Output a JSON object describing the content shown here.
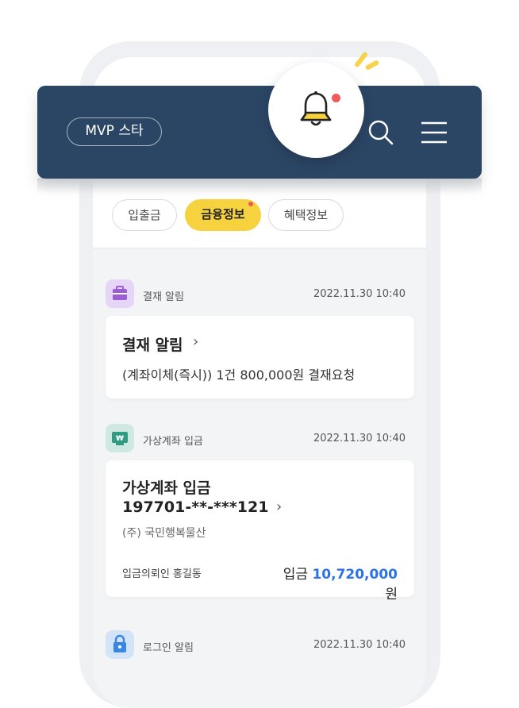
{
  "header": {
    "chip_label": "MVP 스타",
    "bell_icon": "bell-icon",
    "search_icon": "search-icon",
    "menu_icon": "hamburger-menu-icon"
  },
  "tabs": [
    {
      "label": "입출금",
      "active": false
    },
    {
      "label": "금융정보",
      "active": true,
      "has_new": true
    },
    {
      "label": "혜택정보",
      "active": false
    }
  ],
  "notifications": [
    {
      "icon": "briefcase-icon",
      "category": "결재 알림",
      "time": "2022.11.30 10:40",
      "title": "결재 알림",
      "description": "(계좌이체(즉시)) 1건 800,000원 결재요청"
    },
    {
      "icon": "virtual-account-icon",
      "category": "가상계좌 입금",
      "time": "2022.11.30 10:40",
      "title": "가상계좌 입금",
      "account": "197701-**-***121",
      "company": "(주) 국민행복물산",
      "depositor": "입금의뢰인 홍길동",
      "amount_prefix": "입금",
      "amount": "10,720,000",
      "amount_unit": "원"
    },
    {
      "icon": "lock-icon",
      "category": "로그인 알림",
      "time": "2022.11.30 10:40"
    }
  ],
  "colors": {
    "header_bg": "#2b4665",
    "accent_yellow": "#f7d23f",
    "amount_blue": "#2b73e8",
    "alert_red": "#f05a5a"
  }
}
